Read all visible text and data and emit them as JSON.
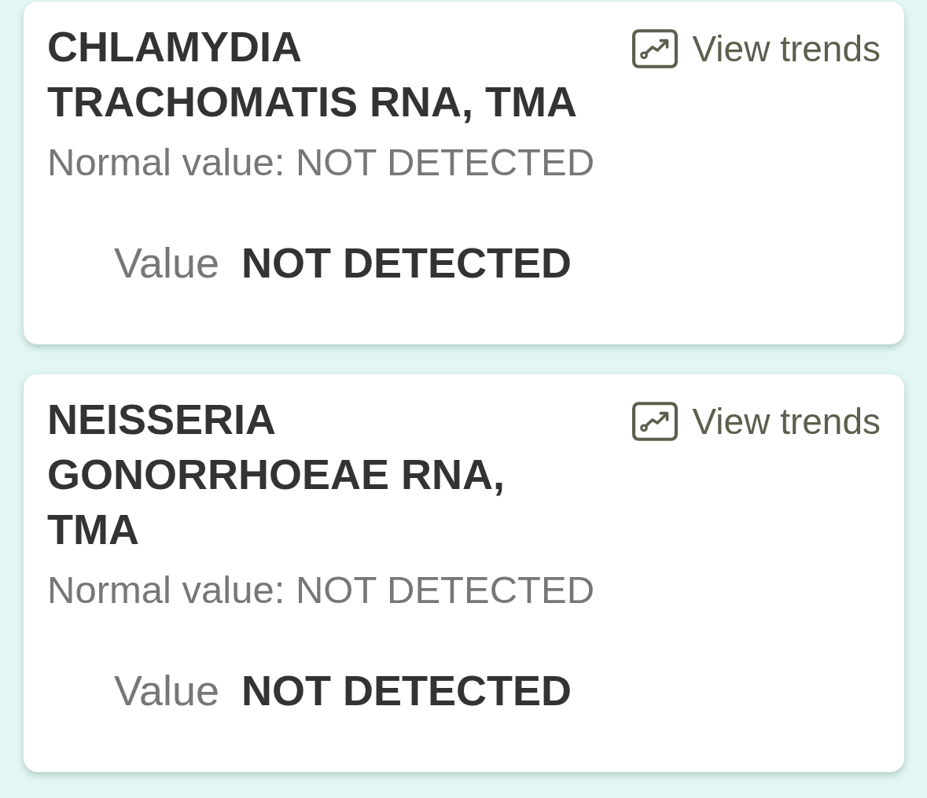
{
  "results": [
    {
      "name": "CHLAMYDIA TRACHOMATIS RNA, TMA",
      "trends_link": "View trends",
      "normal_value": "Normal value: NOT DETECTED",
      "value_label": "Value",
      "value": "NOT DETECTED"
    },
    {
      "name": "NEISSERIA GONORRHOEAE RNA, TMA",
      "trends_link": "View trends",
      "normal_value": "Normal value: NOT DETECTED",
      "value_label": "Value",
      "value": "NOT DETECTED"
    }
  ]
}
